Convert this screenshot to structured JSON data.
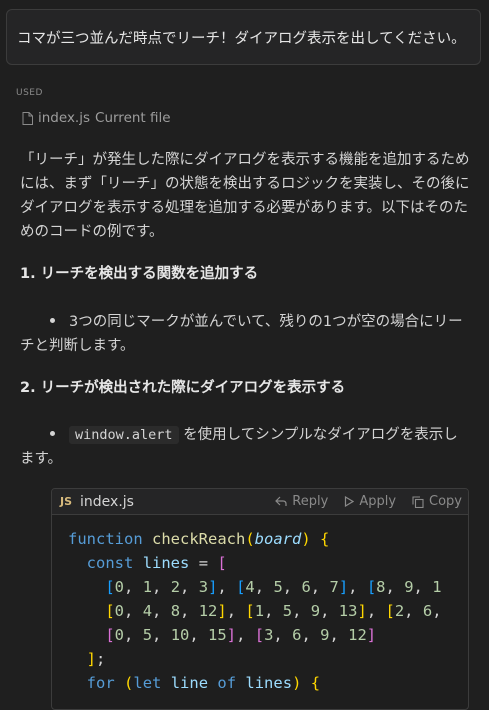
{
  "user_message": "コマが三つ並んだ時点でリーチ！ダイアログ表示を出してください。",
  "used": {
    "label": "USED",
    "file": "index.js",
    "file_note": "Current file"
  },
  "response": {
    "intro": "「リーチ」が発生した際にダイアログを表示する機能を追加するためには、まず「リーチ」の状態を検出するロジックを実装し、その後にダイアログを表示する処理を追加する必要があります。以下はそのためのコードの例です。",
    "steps": [
      {
        "heading": "1. リーチを検出する関数を追加する",
        "bullet": "3つの同じマークが並んでいて、残りの1つが空の場合にリーチと判断します。"
      },
      {
        "heading": "2. リーチが検出された際にダイアログを表示する",
        "bullet_code": "window.alert",
        "bullet_text": "を使用してシンプルなダイアログを表示します。"
      }
    ]
  },
  "code_block": {
    "language_badge": "JS",
    "filename": "index.js",
    "actions": {
      "reply": "Reply",
      "apply": "Apply",
      "copy": "Copy"
    },
    "lines": [
      "function checkReach(board) {",
      "  const lines = [",
      "    [0, 1, 2, 3], [4, 5, 6, 7], [8, 9, 1",
      "    [0, 4, 8, 12], [1, 5, 9, 13], [2, 6,",
      "    [0, 5, 10, 15], [3, 6, 9, 12]",
      "  ];",
      "  for (let line of lines) {"
    ]
  }
}
